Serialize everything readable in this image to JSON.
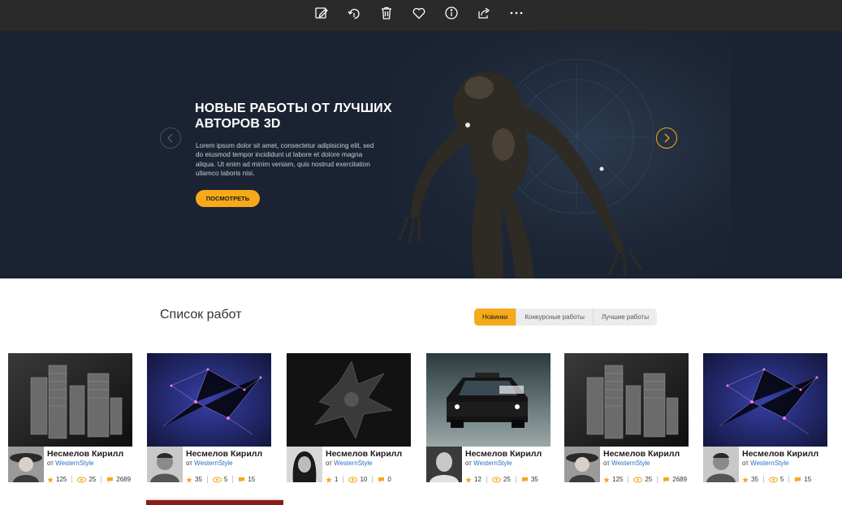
{
  "toolbar": {
    "buttons": [
      {
        "name": "edit-image-button",
        "icon": "edit-icon"
      },
      {
        "name": "rotate-button",
        "icon": "rotate-icon"
      },
      {
        "name": "delete-button",
        "icon": "trash-icon"
      },
      {
        "name": "favorite-button",
        "icon": "heart-icon"
      },
      {
        "name": "info-button",
        "icon": "info-icon"
      },
      {
        "name": "share-button",
        "icon": "share-icon"
      },
      {
        "name": "more-button",
        "icon": "more-icon"
      }
    ]
  },
  "hero": {
    "title_line1": "НОВЫЕ РАБОТЫ ОТ ЛУЧШИХ",
    "title_line2": "АВТОРОВ 3D",
    "text_line1": "Lorem ipsum dolor sit amet, consectetur adipisicing elit, sed",
    "text_line2": "do eiusmod tempor incididunt ut labore et dolore magna",
    "text_line3": "aliqua. Ut enim ad minim veniam, quis nostrud exercitation",
    "text_line4": "ullamco laboris nisi.",
    "button_label": "ПОСМОТРЕТЬ"
  },
  "works": {
    "title": "Список работ",
    "tabs": [
      {
        "label": "Новинки",
        "active": true
      },
      {
        "label": "Конкурсные работы",
        "active": false
      },
      {
        "label": "Лучшие работы",
        "active": false
      }
    ],
    "cards": [
      {
        "thumb": "city",
        "avatar": "woman-hat",
        "author": "Несмелов Кирилл",
        "by": "от",
        "group": "WesternStyle",
        "rating": "125",
        "views": "25",
        "comments": "2689"
      },
      {
        "thumb": "network",
        "avatar": "man-smile",
        "author": "Несмелов Кирилл",
        "by": "от",
        "group": "WesternStyle",
        "rating": "35",
        "views": "5",
        "comments": "15"
      },
      {
        "thumb": "creature",
        "avatar": "woman-dark",
        "author": "Несмелов Кирилл",
        "by": "от",
        "group": "WesternStyle",
        "rating": "1",
        "views": "10",
        "comments": "0"
      },
      {
        "thumb": "police-car",
        "avatar": "man-bald",
        "author": "Несмелов Кирилл",
        "by": "от",
        "group": "WesternStyle",
        "rating": "12",
        "views": "25",
        "comments": "35"
      },
      {
        "thumb": "city",
        "avatar": "woman-hat",
        "author": "Несмелов Кирилл",
        "by": "от",
        "group": "WesternStyle",
        "rating": "125",
        "views": "25",
        "comments": "2689"
      },
      {
        "thumb": "network",
        "avatar": "man-smile",
        "author": "Несмелов Кирилл",
        "by": "от",
        "group": "WesternStyle",
        "rating": "35",
        "views": "5",
        "comments": "15"
      }
    ]
  },
  "colors": {
    "accent": "#f5a91b",
    "hero_bg": "#1b2332",
    "toolbar_bg": "#2a2a2a",
    "link": "#2b6fc4"
  }
}
